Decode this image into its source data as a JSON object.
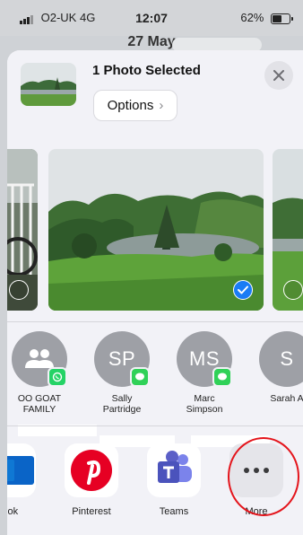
{
  "status_bar": {
    "carrier": "O2-UK",
    "network": "4G",
    "time": "12:07",
    "battery_percent": "62%",
    "battery_level": 0.62
  },
  "background_view": {
    "date": "27 May"
  },
  "share_sheet": {
    "title": "1 Photo Selected",
    "options_label": "Options",
    "close_icon": "close-icon",
    "photos": [
      {
        "position": "previous",
        "selected": false
      },
      {
        "position": "current",
        "selected": true
      },
      {
        "position": "next",
        "selected": false
      }
    ],
    "people": [
      {
        "initials": "",
        "name": "OO GOAT",
        "name_line2": "FAMILY",
        "badge": "whatsapp-icon"
      },
      {
        "initials": "SP",
        "name": "Sally",
        "name_line2": "Partridge",
        "badge": "messages-icon"
      },
      {
        "initials": "MS",
        "name": "Marc",
        "name_line2": "Simpson",
        "badge": "messages-icon"
      },
      {
        "initials": "S",
        "name": "Sarah A",
        "name_line2": "",
        "badge": ""
      }
    ],
    "apps": [
      {
        "label": "look",
        "icon": "outlook-icon"
      },
      {
        "label": "Pinterest",
        "icon": "pinterest-icon"
      },
      {
        "label": "Teams",
        "icon": "teams-icon"
      },
      {
        "label": "More",
        "icon": "more-icon"
      }
    ]
  },
  "colors": {
    "selection_blue": "#1a7cf5",
    "annotation_red": "#e4141b",
    "pinterest_red": "#e60023",
    "teams_purple": "#5b5fc7",
    "outlook_blue": "#0a64c7"
  }
}
